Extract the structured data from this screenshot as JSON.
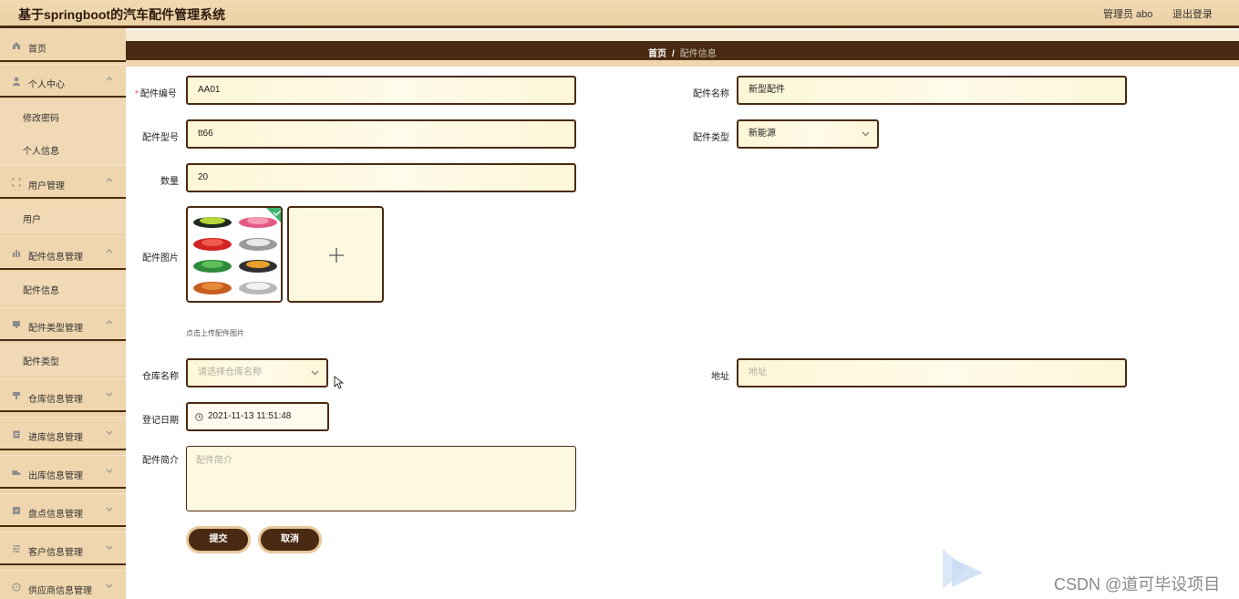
{
  "header": {
    "app_title": "基于springboot的汽车配件管理系统",
    "user_label": "管理员 abo",
    "logout_label": "退出登录"
  },
  "sidebar": {
    "home": "首页",
    "groups": [
      {
        "label": "个人中心",
        "icon": "user-icon",
        "children": [
          "修改密码",
          "个人信息"
        ]
      },
      {
        "label": "用户管理",
        "icon": "frame-icon",
        "children": [
          "用户"
        ]
      },
      {
        "label": "配件信息管理",
        "icon": "chart-icon",
        "children": [
          "配件信息"
        ]
      },
      {
        "label": "配件类型管理",
        "icon": "monitor-icon",
        "children": [
          "配件类型"
        ]
      },
      {
        "label": "仓库信息管理",
        "icon": "cup-icon",
        "children": []
      },
      {
        "label": "进库信息管理",
        "icon": "clipboard-icon",
        "children": []
      },
      {
        "label": "出库信息管理",
        "icon": "truck-icon",
        "children": []
      },
      {
        "label": "盘点信息管理",
        "icon": "box-icon",
        "children": []
      },
      {
        "label": "客户信息管理",
        "icon": "sliders-icon",
        "children": []
      },
      {
        "label": "供应商信息管理",
        "icon": "compass-icon",
        "children": []
      }
    ]
  },
  "breadcrumb": {
    "home": "首页",
    "separator": "/",
    "current": "配件信息"
  },
  "form": {
    "part_no": {
      "label": "配件编号",
      "value": "AA01"
    },
    "part_name": {
      "label": "配件名称",
      "value": "新型配件"
    },
    "part_model": {
      "label": "配件型号",
      "value": "tt66"
    },
    "part_type": {
      "label": "配件类型",
      "value": "新能源"
    },
    "quantity": {
      "label": "数量",
      "value": "20"
    },
    "image": {
      "label": "配件图片",
      "hint": "点击上传配件图片"
    },
    "warehouse": {
      "label": "仓库名称",
      "placeholder": "请选择仓库名称"
    },
    "address": {
      "label": "地址",
      "placeholder": "地址"
    },
    "reg_date": {
      "label": "登记日期",
      "value": "2021-11-13 11:51:48"
    },
    "intro": {
      "label": "配件简介",
      "placeholder": "配件简介"
    }
  },
  "buttons": {
    "submit": "提交",
    "cancel": "取消"
  },
  "watermark": "CSDN @道可毕设项目",
  "colors": {
    "accent_dark": "#4a2a12",
    "sidebar_bg": "#ecd2a8",
    "field_bg": "#fdf6d6",
    "required": "#e2525a"
  }
}
